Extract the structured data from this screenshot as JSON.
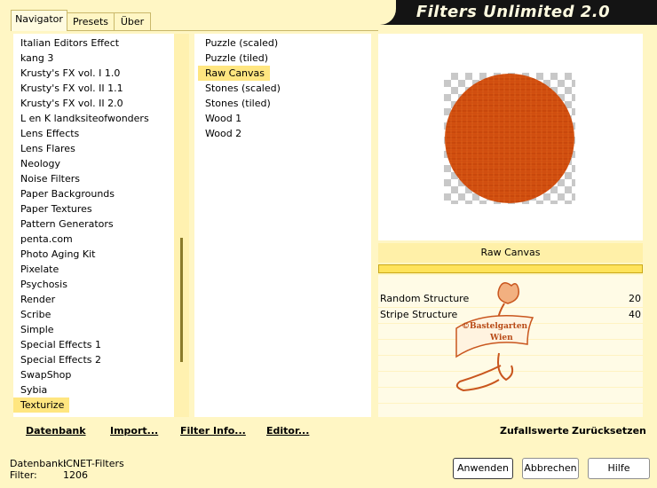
{
  "app": {
    "title": "Filters Unlimited 2.0"
  },
  "tabs": [
    {
      "label": "Navigator",
      "active": true
    },
    {
      "label": "Presets",
      "active": false
    },
    {
      "label": "Über",
      "active": false
    }
  ],
  "categories": [
    "Italian Editors Effect",
    "kang 3",
    "Krusty's FX vol. I 1.0",
    "Krusty's FX vol. II 1.1",
    "Krusty's FX vol. II 2.0",
    "L en K landksiteofwonders",
    "Lens Effects",
    "Lens Flares",
    "Neology",
    "Noise Filters",
    "Paper Backgrounds",
    "Paper Textures",
    "Pattern Generators",
    "penta.com",
    "Photo Aging Kit",
    "Pixelate",
    "Psychosis",
    "Render",
    "Scribe",
    "Simple",
    "Special Effects 1",
    "Special Effects 2",
    "SwapShop",
    "Sybia",
    "Texturize"
  ],
  "selected_category": "Texturize",
  "filters": [
    "Puzzle (scaled)",
    "Puzzle (tiled)",
    "Raw Canvas",
    "Stones (scaled)",
    "Stones (tiled)",
    "Wood 1",
    "Wood 2"
  ],
  "selected_filter": "Raw Canvas",
  "preview": {
    "filter_name": "Raw Canvas",
    "circle_color": "#d4500f"
  },
  "params": [
    {
      "label": "Random Structure",
      "value": "20"
    },
    {
      "label": "Stripe Structure",
      "value": "40"
    }
  ],
  "watermark": {
    "line1": "©Bastelgarten",
    "line2": "Wien"
  },
  "bottom_links": {
    "database": "Datenbank",
    "import": "Import...",
    "filter_info": "Filter Info...",
    "editor": "Editor...",
    "random": "Zufallswerte",
    "reset": "Zurücksetzen"
  },
  "status": {
    "db_label": "Datenbank:",
    "db_value": "ICNET-Filters",
    "filter_label": "Filter:",
    "filter_value": "1206"
  },
  "buttons": {
    "apply": "Anwenden",
    "cancel": "Abbrechen",
    "help": "Hilfe"
  },
  "colors": {
    "background": "#fff6c4",
    "selection": "#ffe680",
    "header": "#141414"
  }
}
